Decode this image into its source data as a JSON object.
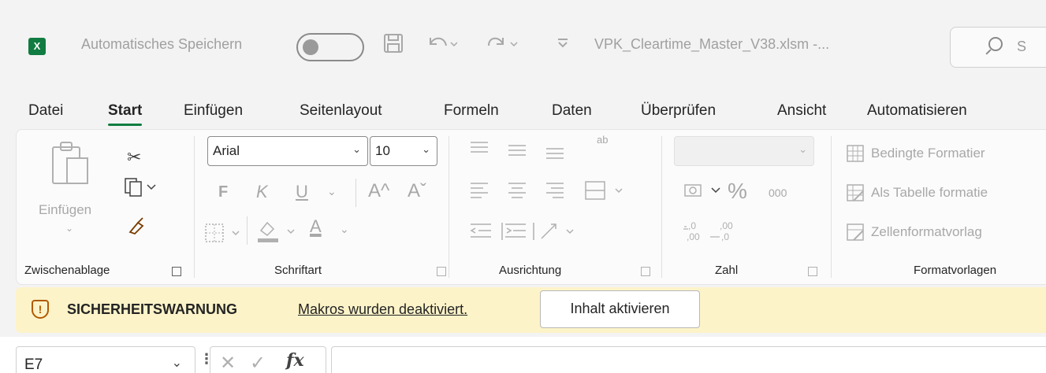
{
  "titlebar": {
    "app_logo": "X",
    "autosave_label": "Automatisches Speichern",
    "autosave_state": "off",
    "save_icon": "save-icon",
    "undo_icon": "undo-icon",
    "redo_icon": "redo-icon",
    "customize_icon": "customize-qat-icon",
    "doc_title": "VPK_Cleartime_Master_V38.xlsm  -...",
    "search_placeholder": "S"
  },
  "tabs": [
    "Datei",
    "Start",
    "Einfügen",
    "Seitenlayout",
    "Formeln",
    "Daten",
    "Überprüfen",
    "Ansicht",
    "Automatisieren"
  ],
  "active_tab": "Start",
  "ribbon": {
    "clipboard": {
      "paste_label": "Einfügen",
      "group_label": "Zwischenablage"
    },
    "font": {
      "font_name": "Arial",
      "font_size": "10",
      "bold": "F",
      "italic": "K",
      "underline": "U",
      "grow": "A^",
      "shrink": "Aˇ",
      "font_color_letter": "A",
      "group_label": "Schriftart"
    },
    "alignment": {
      "wrap_label": "ab",
      "group_label": "Ausrichtung"
    },
    "number": {
      "format_value": "",
      "percent": "%",
      "thousands": "000",
      "inc_decimal": "←,0 ,00",
      "dec_decimal": ",00 →,0",
      "group_label": "Zahl"
    },
    "styles": {
      "conditional": "Bedingte Formatier",
      "as_table": "Als Tabelle formatie",
      "cell_styles": "Zellenformatvorlag",
      "group_label": "Formatvorlagen"
    }
  },
  "security_bar": {
    "title": "SICHERHEITSWARNUNG",
    "message": "Makros wurden deaktiviert.",
    "button": "Inhalt aktivieren"
  },
  "formula_bar": {
    "name_box": "E7",
    "cancel": "✕",
    "enter": "✓",
    "fx": "fx",
    "content": ""
  },
  "colors": {
    "accent": "#107c41",
    "warning_bg": "#fdf3c9",
    "warning_icon": "#b15a00"
  }
}
